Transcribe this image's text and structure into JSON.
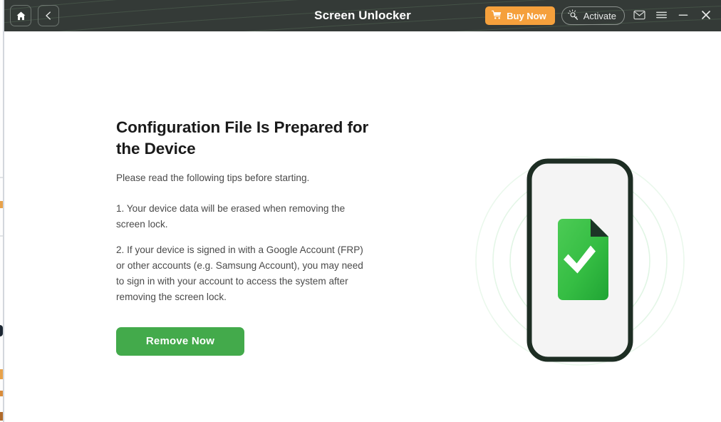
{
  "window": {
    "title": "Screen Unlocker"
  },
  "titlebar": {
    "home_label": "Home",
    "back_label": "Back",
    "buy_now_label": "Buy Now",
    "activate_label": "Activate",
    "feedback_label": "Feedback",
    "menu_label": "Menu",
    "minimize_label": "Minimize",
    "close_label": "Close",
    "icons": {
      "home": "home-icon",
      "back": "chevron-left-icon",
      "cart": "shopping-cart-icon",
      "activate": "key-sparkle-icon",
      "mail": "envelope-icon",
      "menu": "hamburger-menu-icon",
      "minimize": "minimize-icon",
      "close": "close-icon"
    },
    "colors": {
      "background": "#343a37",
      "buy_now": "#f5a03c",
      "title_text": "#ffffff"
    }
  },
  "main": {
    "title": "Configuration File Is Prepared for the Device",
    "subtitle": "Please read the following tips before starting.",
    "tips": [
      "1. Your device data will be erased when removing the screen lock.",
      "2. If your device is signed in with a Google Account (FRP) or other accounts (e.g. Samsung Account), you may need to sign in with your account to access the system after removing the screen lock."
    ],
    "primary_button": "Remove Now",
    "colors": {
      "primary_button": "#43aa4b",
      "heading_text": "#1a1a1a",
      "body_text": "#4a4a4a"
    }
  },
  "illustration": {
    "name": "phone-with-configuration-file-ready",
    "phone_frame_color": "#1d2d23",
    "phone_screen_color": "#f4f4f4",
    "document_color": "#33bb44",
    "check_color": "#ffffff",
    "ripple_color": "#e8f7ea",
    "icons": {
      "phone": "smartphone-icon",
      "document": "document-check-icon",
      "check": "checkmark-icon"
    }
  }
}
